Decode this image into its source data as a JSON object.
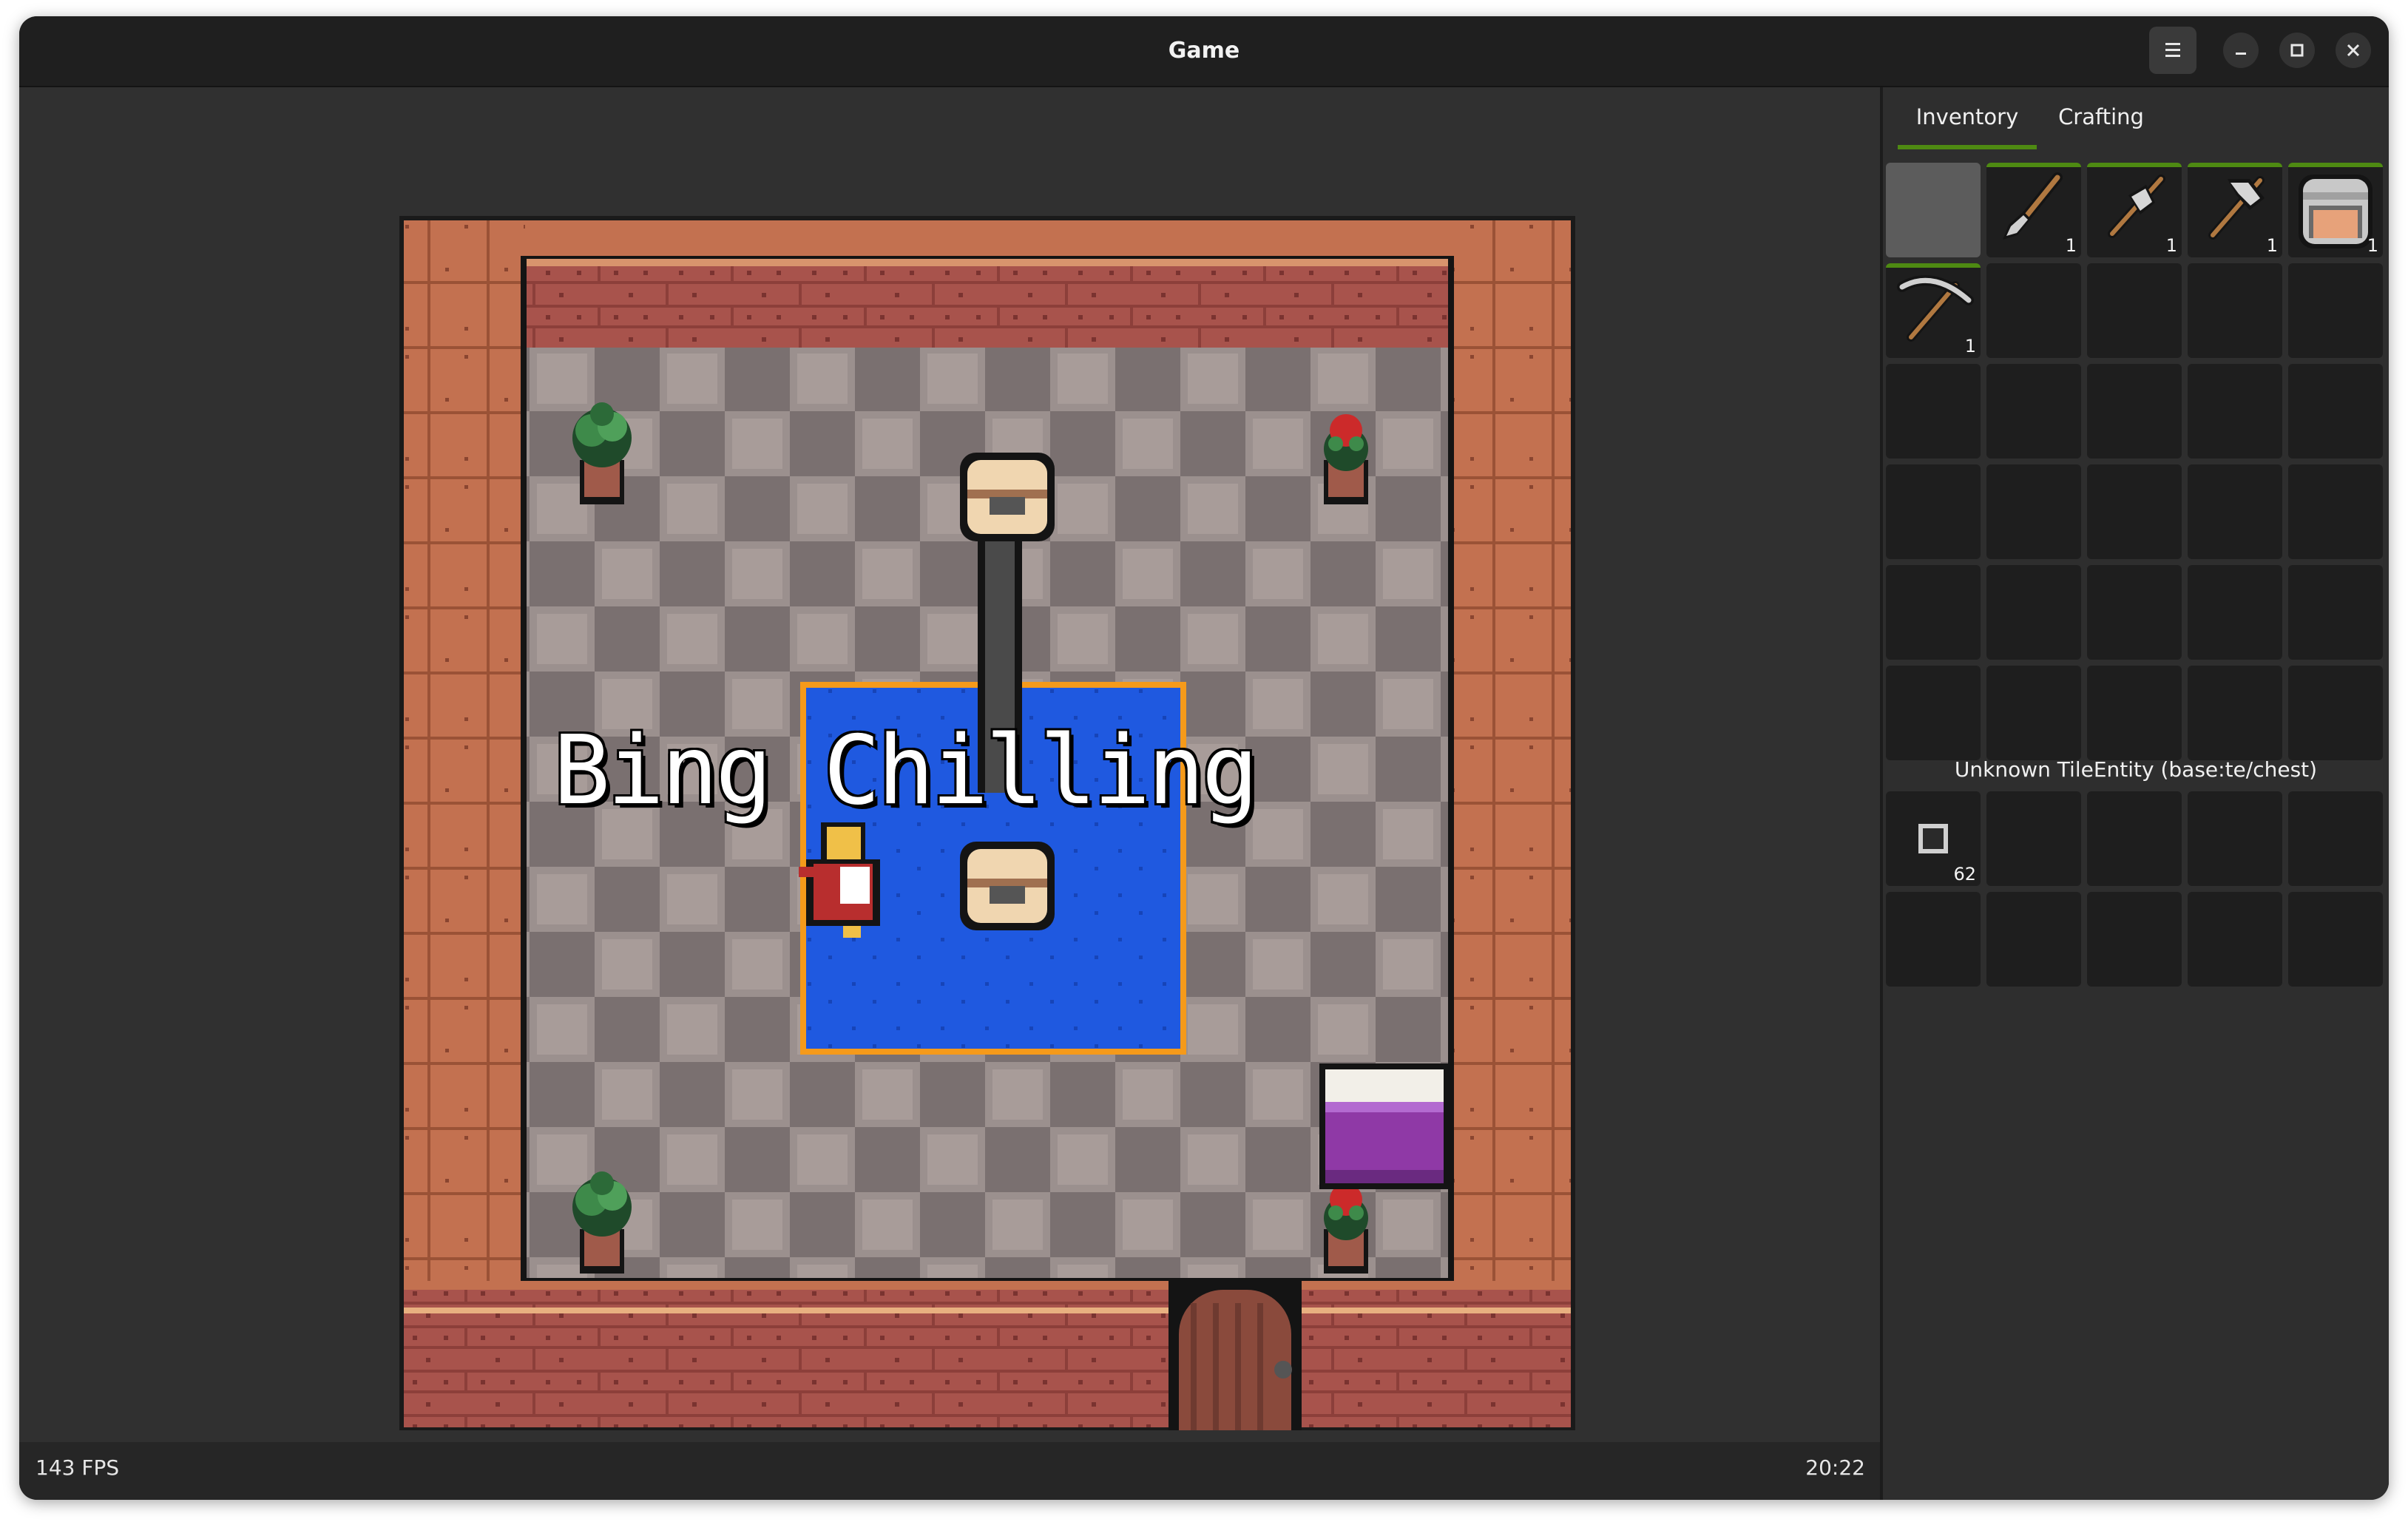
{
  "window": {
    "title": "Game"
  },
  "icons": {
    "menu": "hamburger-menu-icon",
    "minimize": "minimize-icon",
    "maximize": "maximize-icon",
    "close": "close-icon"
  },
  "status": {
    "fps": "143 FPS",
    "time": "20:22"
  },
  "game": {
    "overlay_text": "Bing Chilling",
    "colors": {
      "rug": "#1f59e0",
      "rug_border": "#f59a1a",
      "wall": "#c3704e",
      "bed": "#8f39a6"
    }
  },
  "inventory": {
    "tabs": [
      {
        "label": "Inventory",
        "active": true
      },
      {
        "label": "Crafting",
        "active": false
      }
    ],
    "slots": [
      {
        "item": "",
        "count": "",
        "selected": true
      },
      {
        "item": "shovel",
        "count": "1",
        "selected": false
      },
      {
        "item": "axe",
        "count": "1",
        "selected": false
      },
      {
        "item": "hammer",
        "count": "1",
        "selected": false
      },
      {
        "item": "furnace",
        "count": "1",
        "selected": false
      },
      {
        "item": "pickaxe",
        "count": "1",
        "selected": false
      }
    ],
    "chest_title": "Unknown TileEntity (base:te/chest)",
    "chest_slots": [
      {
        "item": "dark-block",
        "count": "62"
      }
    ]
  }
}
